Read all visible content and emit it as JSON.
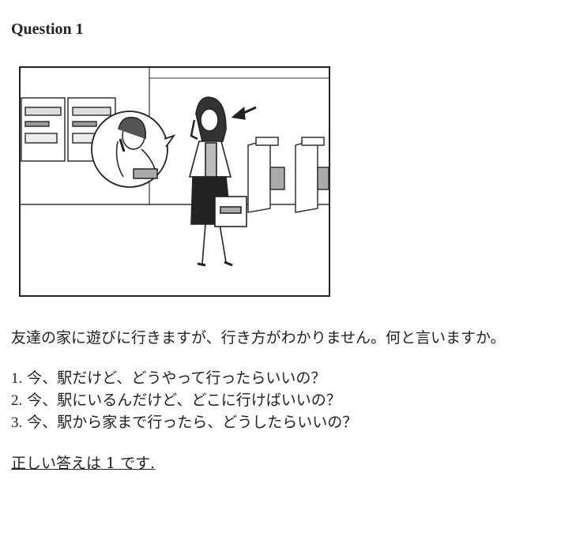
{
  "title": "Question 1",
  "prompt": "友達の家に遊びに行きますが、行き方がわかりません。何と言いますか。",
  "choices": [
    {
      "num": "1.",
      "text": "今、駅だけど、どうやって行ったらいいの？"
    },
    {
      "num": "2.",
      "text": "今、駅にいるんだけど、どこに行けばいいの？"
    },
    {
      "num": "3.",
      "text": "今、駅から家まで行ったら、どうしたらいいの？"
    }
  ],
  "answer": "正しい答えは 1 です."
}
